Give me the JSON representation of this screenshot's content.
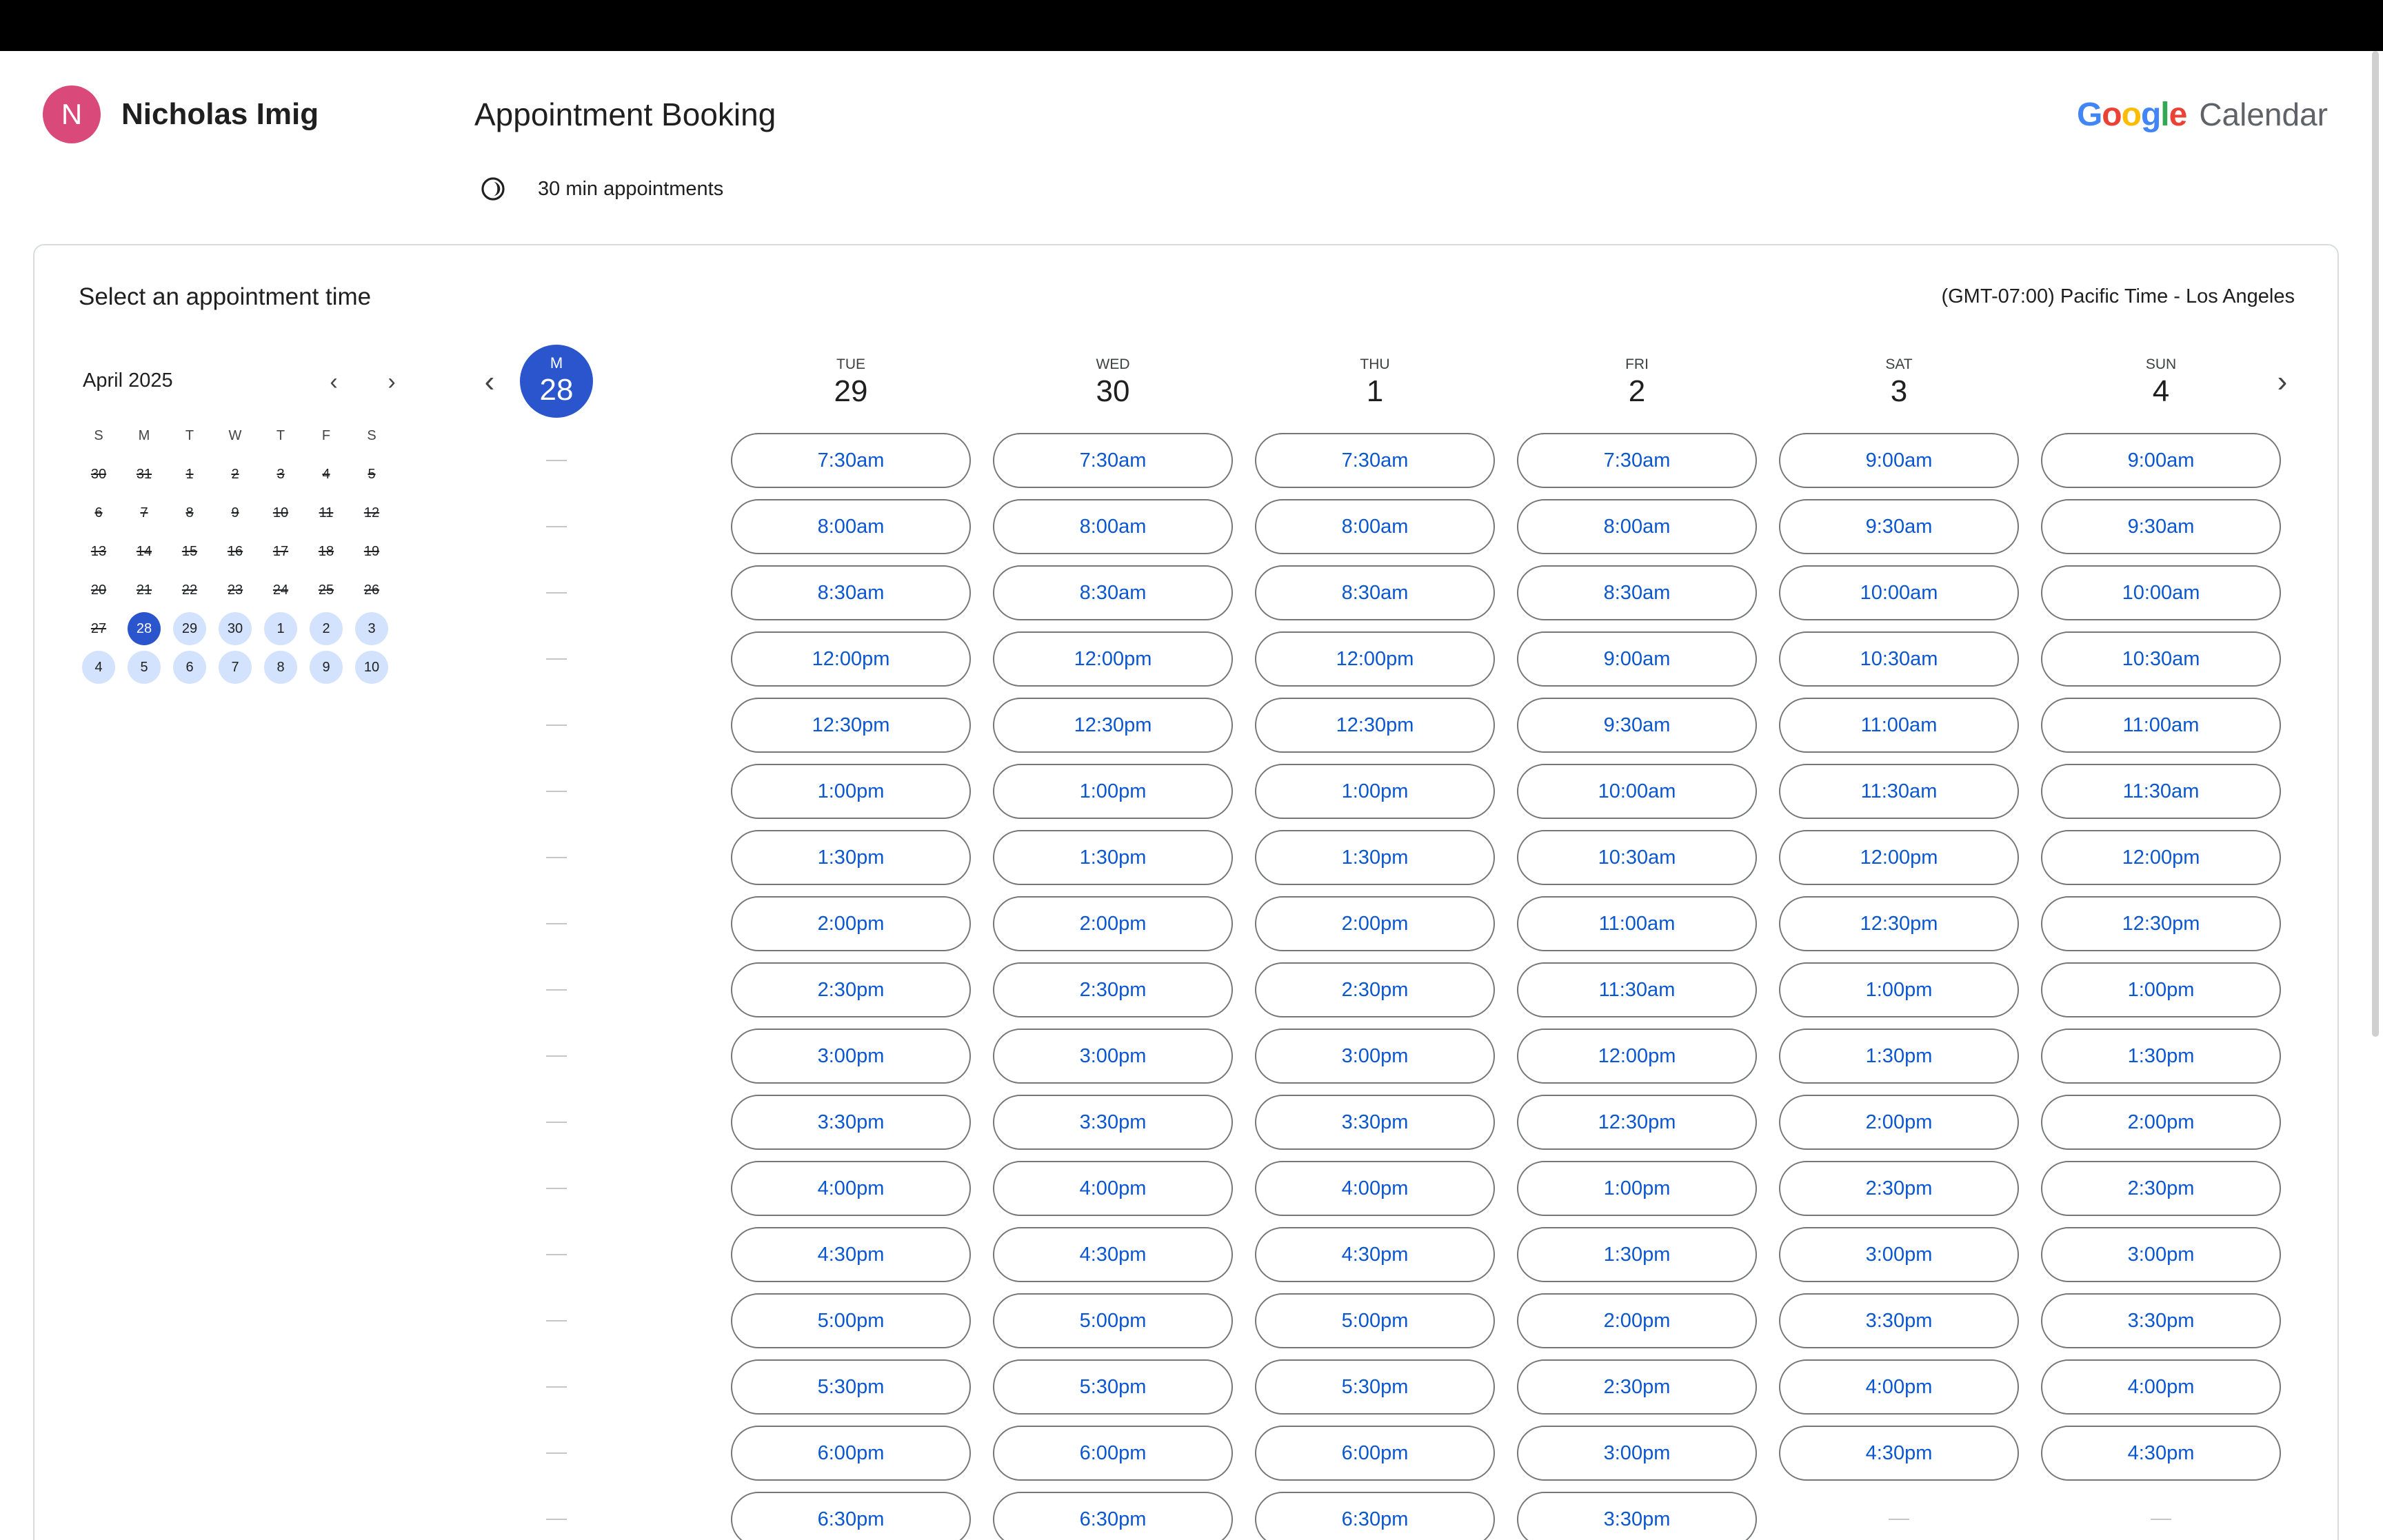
{
  "user": {
    "initial": "N",
    "name": "Nicholas Imig"
  },
  "page_title": "Appointment Booking",
  "duration_label": "30 min appointments",
  "brand": {
    "google": "Google",
    "calendar": "Calendar"
  },
  "card": {
    "title": "Select an appointment time",
    "timezone": "(GMT-07:00) Pacific Time - Los Angeles"
  },
  "mini_calendar": {
    "month_label": "April 2025",
    "weekday_labels": [
      "S",
      "M",
      "T",
      "W",
      "T",
      "F",
      "S"
    ],
    "days": [
      {
        "label": "30",
        "state": "past"
      },
      {
        "label": "31",
        "state": "past"
      },
      {
        "label": "1",
        "state": "past"
      },
      {
        "label": "2",
        "state": "past"
      },
      {
        "label": "3",
        "state": "past"
      },
      {
        "label": "4",
        "state": "past"
      },
      {
        "label": "5",
        "state": "past"
      },
      {
        "label": "6",
        "state": "past"
      },
      {
        "label": "7",
        "state": "past"
      },
      {
        "label": "8",
        "state": "past"
      },
      {
        "label": "9",
        "state": "past"
      },
      {
        "label": "10",
        "state": "past"
      },
      {
        "label": "11",
        "state": "past"
      },
      {
        "label": "12",
        "state": "past"
      },
      {
        "label": "13",
        "state": "past"
      },
      {
        "label": "14",
        "state": "past"
      },
      {
        "label": "15",
        "state": "past"
      },
      {
        "label": "16",
        "state": "past"
      },
      {
        "label": "17",
        "state": "past"
      },
      {
        "label": "18",
        "state": "past"
      },
      {
        "label": "19",
        "state": "past"
      },
      {
        "label": "20",
        "state": "past"
      },
      {
        "label": "21",
        "state": "past"
      },
      {
        "label": "22",
        "state": "past"
      },
      {
        "label": "23",
        "state": "past"
      },
      {
        "label": "24",
        "state": "past"
      },
      {
        "label": "25",
        "state": "past"
      },
      {
        "label": "26",
        "state": "past"
      },
      {
        "label": "27",
        "state": "past"
      },
      {
        "label": "28",
        "state": "selected"
      },
      {
        "label": "29",
        "state": "available"
      },
      {
        "label": "30",
        "state": "available"
      },
      {
        "label": "1",
        "state": "available"
      },
      {
        "label": "2",
        "state": "available"
      },
      {
        "label": "3",
        "state": "available"
      },
      {
        "label": "4",
        "state": "available"
      },
      {
        "label": "5",
        "state": "available"
      },
      {
        "label": "6",
        "state": "available"
      },
      {
        "label": "7",
        "state": "available"
      },
      {
        "label": "8",
        "state": "available"
      },
      {
        "label": "9",
        "state": "available"
      },
      {
        "label": "10",
        "state": "available"
      }
    ]
  },
  "week": [
    {
      "dow": "M",
      "num": "28",
      "selected": true,
      "slots": [],
      "empty_count": 17
    },
    {
      "dow": "TUE",
      "num": "29",
      "selected": false,
      "slots": [
        "7:30am",
        "8:00am",
        "8:30am",
        "12:00pm",
        "12:30pm",
        "1:00pm",
        "1:30pm",
        "2:00pm",
        "2:30pm",
        "3:00pm",
        "3:30pm",
        "4:00pm",
        "4:30pm",
        "5:00pm",
        "5:30pm",
        "6:00pm",
        "6:30pm"
      ],
      "empty_count": 0
    },
    {
      "dow": "WED",
      "num": "30",
      "selected": false,
      "slots": [
        "7:30am",
        "8:00am",
        "8:30am",
        "12:00pm",
        "12:30pm",
        "1:00pm",
        "1:30pm",
        "2:00pm",
        "2:30pm",
        "3:00pm",
        "3:30pm",
        "4:00pm",
        "4:30pm",
        "5:00pm",
        "5:30pm",
        "6:00pm",
        "6:30pm"
      ],
      "empty_count": 0
    },
    {
      "dow": "THU",
      "num": "1",
      "selected": false,
      "slots": [
        "7:30am",
        "8:00am",
        "8:30am",
        "12:00pm",
        "12:30pm",
        "1:00pm",
        "1:30pm",
        "2:00pm",
        "2:30pm",
        "3:00pm",
        "3:30pm",
        "4:00pm",
        "4:30pm",
        "5:00pm",
        "5:30pm",
        "6:00pm",
        "6:30pm"
      ],
      "empty_count": 0
    },
    {
      "dow": "FRI",
      "num": "2",
      "selected": false,
      "slots": [
        "7:30am",
        "8:00am",
        "8:30am",
        "9:00am",
        "9:30am",
        "10:00am",
        "10:30am",
        "11:00am",
        "11:30am",
        "12:00pm",
        "12:30pm",
        "1:00pm",
        "1:30pm",
        "2:00pm",
        "2:30pm",
        "3:00pm",
        "3:30pm"
      ],
      "empty_count": 0
    },
    {
      "dow": "SAT",
      "num": "3",
      "selected": false,
      "slots": [
        "9:00am",
        "9:30am",
        "10:00am",
        "10:30am",
        "11:00am",
        "11:30am",
        "12:00pm",
        "12:30pm",
        "1:00pm",
        "1:30pm",
        "2:00pm",
        "2:30pm",
        "3:00pm",
        "3:30pm",
        "4:00pm",
        "4:30pm"
      ],
      "empty_count": 1
    },
    {
      "dow": "SUN",
      "num": "4",
      "selected": false,
      "slots": [
        "9:00am",
        "9:30am",
        "10:00am",
        "10:30am",
        "11:00am",
        "11:30am",
        "12:00pm",
        "12:30pm",
        "1:00pm",
        "1:30pm",
        "2:00pm",
        "2:30pm",
        "3:00pm",
        "3:30pm",
        "4:00pm",
        "4:30pm"
      ],
      "empty_count": 1
    }
  ],
  "colors": {
    "accent": "#2a55cc",
    "slot_text": "#0b57d0",
    "available_day": "#d3e3fd",
    "avatar": "#d9497a"
  }
}
